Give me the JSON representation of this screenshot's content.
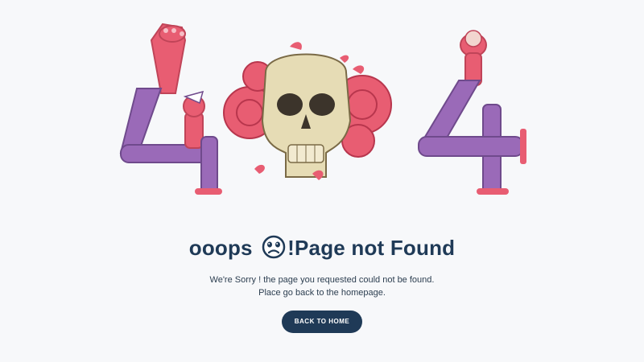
{
  "error_page": {
    "title_prefix": "ooops ",
    "title_suffix": "!Page not Found",
    "emoji_icon": "sad-face-icon",
    "message_line1": "We're Sorry ! the page you requested could not be found.",
    "message_line2": "Place go back to the homepage.",
    "button_label": "BACK TO HOME"
  },
  "colors": {
    "background": "#f7f8fa",
    "heading": "#1f3a57",
    "button": "#1f3a57",
    "pink": "#e85d72",
    "purple": "#9a6ab8",
    "bone": "#e6dcb5"
  }
}
